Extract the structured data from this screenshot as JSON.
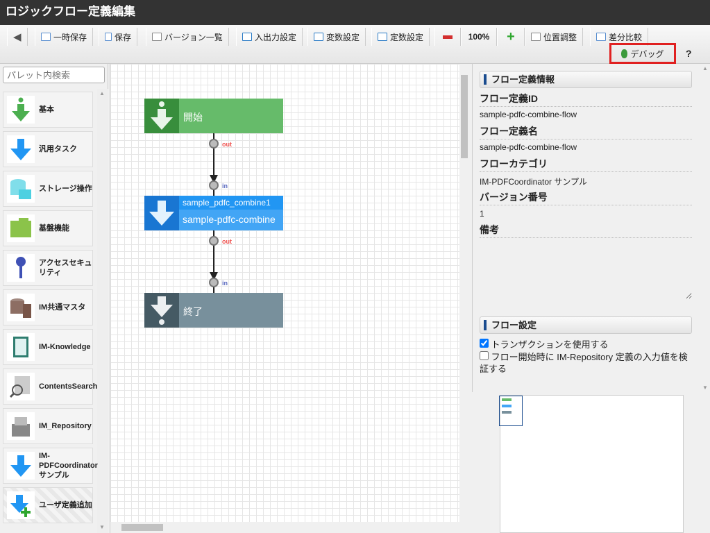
{
  "title": "ロジックフロー定義編集",
  "toolbar": {
    "back": "",
    "temp_save": "一時保存",
    "save": "保存",
    "versions": "バージョン一覧",
    "io": "入出力設定",
    "vars": "変数設定",
    "consts": "定数設定",
    "zoom": "100%",
    "position": "位置調整",
    "diff": "差分比較",
    "debug": "デバッグ",
    "help": "?"
  },
  "palette": {
    "search_placeholder": "パレット内検索",
    "items": [
      {
        "label": "基本"
      },
      {
        "label": "汎用タスク"
      },
      {
        "label": "ストレージ操作"
      },
      {
        "label": "基盤機能"
      },
      {
        "label": "アクセスセキュリティ"
      },
      {
        "label": "IM共通マスタ"
      },
      {
        "label": "IM-Knowledge"
      },
      {
        "label": "ContentsSearch"
      },
      {
        "label": "IM_Repository"
      },
      {
        "label": "IM-PDFCoordinator サンプル"
      },
      {
        "label": "ユーザ定義追加"
      }
    ]
  },
  "flow": {
    "start": "開始",
    "task_id": "sample_pdfc_combine1",
    "task_name": "sample-pdfc-combine",
    "end": "終了",
    "out": "out",
    "in": "in"
  },
  "props": {
    "section1": "フロー定義情報",
    "id_label": "フロー定義ID",
    "id": "sample-pdfc-combine-flow",
    "name_label": "フロー定義名",
    "name": "sample-pdfc-combine-flow",
    "cat_label": "フローカテゴリ",
    "cat": "IM-PDFCoordinator サンプル",
    "ver_label": "バージョン番号",
    "ver": "1",
    "note_label": "備考",
    "note": "",
    "section2": "フロー設定",
    "cb1": "トランザクションを使用する",
    "cb1_checked": true,
    "cb2": "フロー開始時に IM-Repository 定義の入力値を検証する",
    "cb2_checked": false
  },
  "colors": {
    "start": "#66bb6a",
    "task": "#42a5f5",
    "end": "#78909c",
    "highlight": "#e02020"
  }
}
